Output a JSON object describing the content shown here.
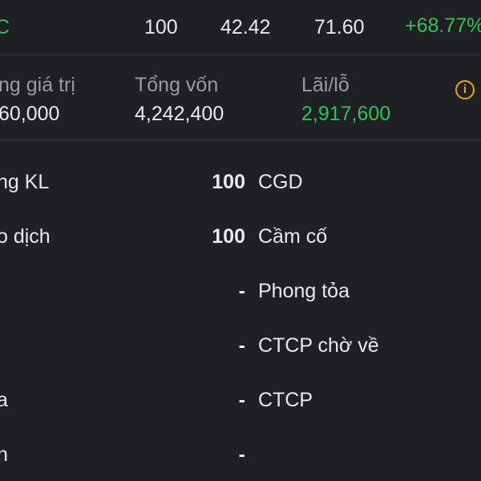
{
  "top_row": {
    "symbol_fragment": "C",
    "quantity": "100",
    "avg_price": "42.42",
    "market_price": "71.60",
    "change_pct": "+68.77%"
  },
  "summary": {
    "market_value_label": "ng giá trị",
    "market_value": "60,000",
    "capital_label": "Tổng vốn",
    "capital": "4,242,400",
    "pnl_label": "Lãi/lỗ",
    "pnl": "2,917,600",
    "info_icon": "info-icon"
  },
  "details": {
    "rows": [
      {
        "left_label": "ng KL",
        "value": "100",
        "right_label": "CGD"
      },
      {
        "left_label": "o dịch",
        "value": "100",
        "right_label": "Cầm cố"
      },
      {
        "left_label": "",
        "value": "-",
        "right_label": "Phong tỏa"
      },
      {
        "left_label": "",
        "value": "-",
        "right_label": "CTCP chờ về"
      },
      {
        "left_label": "a",
        "value": "-",
        "right_label": "CTCP"
      },
      {
        "left_label": "n",
        "value": "-",
        "right_label": ""
      }
    ]
  },
  "colors": {
    "background": "#1f2023",
    "positive": "#33c15a",
    "warning": "#f0a30a"
  }
}
